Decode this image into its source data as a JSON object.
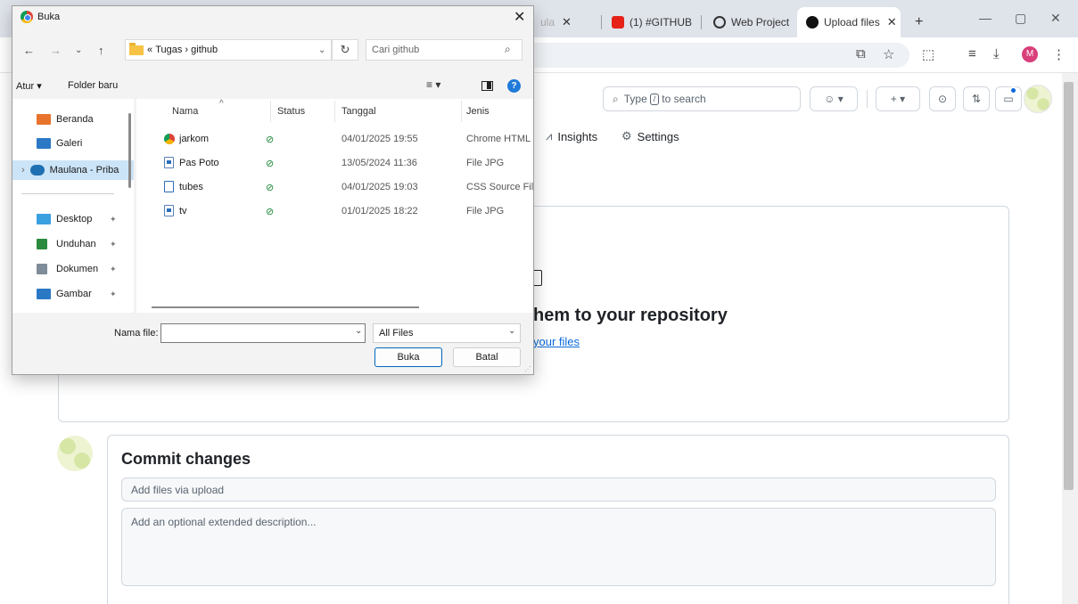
{
  "browser": {
    "tabs": [
      {
        "label": "ula",
        "favicon_color": "#888888"
      },
      {
        "label": "(1) #GITHUB",
        "favicon_color": "#e62117"
      },
      {
        "label": "Web Project",
        "favicon_color": "#333333"
      },
      {
        "label": "Upload files",
        "favicon_color": "#111111"
      }
    ],
    "new_tab": "+",
    "active_tab_index": 3
  },
  "github": {
    "search_placeholder_prefix": "Type",
    "search_key": "/",
    "search_placeholder_suffix": "to search",
    "nav": [
      {
        "label": "Insights",
        "icon": "graph-icon"
      },
      {
        "label": "Settings",
        "icon": "gear-icon"
      }
    ],
    "drop_title": "hem to your repository",
    "drop_link": "your files",
    "commit": {
      "title": "Commit changes",
      "summary_placeholder": "Add files via upload",
      "description_placeholder": "Add an optional extended description..."
    }
  },
  "dialog": {
    "title": "Buka",
    "address": {
      "prefix": "«",
      "crumbs": [
        "Tugas",
        "github"
      ],
      "separator": "›"
    },
    "search_placeholder": "Cari github",
    "commands": {
      "organize": "Atur ▾",
      "new_folder": "Folder baru"
    },
    "nav_items": [
      {
        "label": "Beranda",
        "color": "#e8732c",
        "selected": false,
        "pinned": false
      },
      {
        "label": "Galeri",
        "color": "#2b78c5",
        "selected": false,
        "pinned": false
      },
      {
        "label": "Maulana - Priba",
        "color": "#1f6fb3",
        "selected": true,
        "pinned": false,
        "expandable": true
      },
      {
        "label": "Desktop",
        "color": "#3aa0e0",
        "selected": false,
        "pinned": true
      },
      {
        "label": "Unduhan",
        "color": "#2b8a3e",
        "selected": false,
        "pinned": true
      },
      {
        "label": "Dokumen",
        "color": "#7f8c99",
        "selected": false,
        "pinned": true
      },
      {
        "label": "Gambar",
        "color": "#2b78c5",
        "selected": false,
        "pinned": true
      }
    ],
    "columns": [
      "Nama",
      "Status",
      "Tanggal",
      "Jenis"
    ],
    "files": [
      {
        "name": "jarkom",
        "status": "⊘",
        "date": "04/01/2025 19:55",
        "type": "Chrome HTML Do...",
        "icon": "chrome"
      },
      {
        "name": "Pas Poto",
        "status": "⊘",
        "date": "13/05/2024 11:36",
        "type": "File JPG",
        "icon": "jpg"
      },
      {
        "name": "tubes",
        "status": "⊘",
        "date": "04/01/2025 19:03",
        "type": "CSS Source File",
        "icon": "css"
      },
      {
        "name": "tv",
        "status": "⊘",
        "date": "01/01/2025 18:22",
        "type": "File JPG",
        "icon": "jpg"
      }
    ],
    "filename_label": "Nama file:",
    "filename_value": "",
    "filetype": "All Files",
    "open_button": "Buka",
    "cancel_button": "Batal"
  },
  "colors": {
    "accent": "#0969da",
    "dialog_bg": "#f3f3f3",
    "selection": "#cce4f7"
  }
}
